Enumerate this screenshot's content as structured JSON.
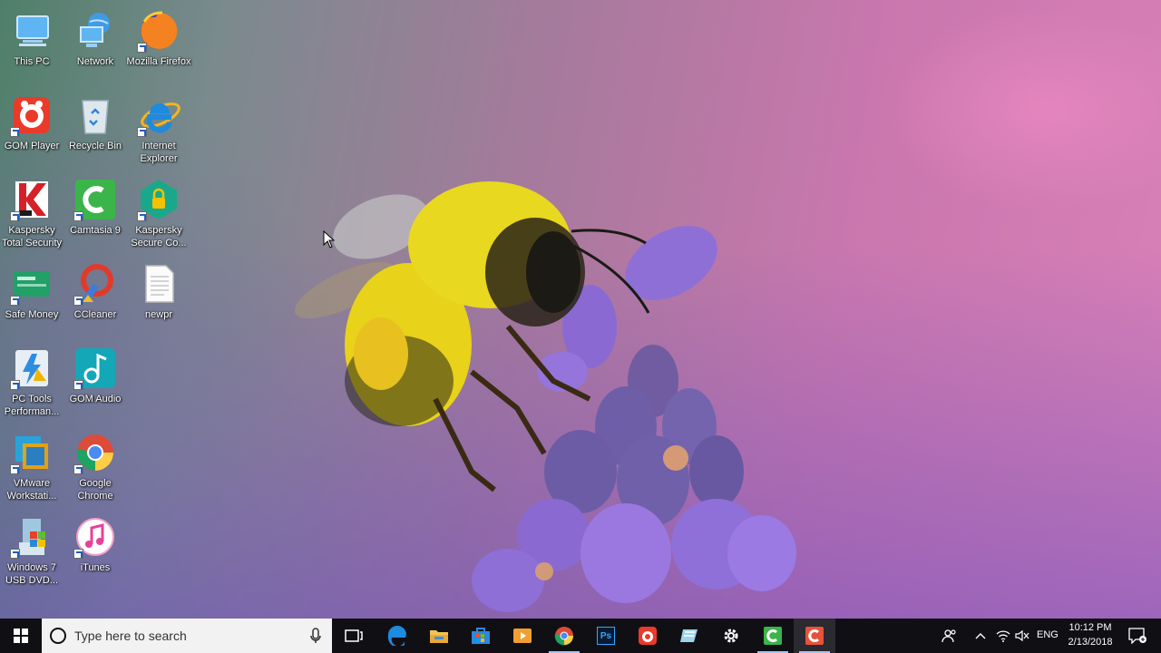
{
  "desktop": {
    "icons": [
      {
        "label": "This PC",
        "icon": "this-pc-icon"
      },
      {
        "label": "Network",
        "icon": "network-icon"
      },
      {
        "label": "Mozilla Firefox",
        "icon": "firefox-icon"
      },
      {
        "label": "GOM Player",
        "icon": "gom-player-icon"
      },
      {
        "label": "Recycle Bin",
        "icon": "recycle-bin-icon"
      },
      {
        "label": "Internet Explorer",
        "icon": "internet-explorer-icon"
      },
      {
        "label": "Kaspersky Total Security",
        "icon": "kaspersky-icon"
      },
      {
        "label": "Camtasia 9",
        "icon": "camtasia-icon"
      },
      {
        "label": "Kaspersky Secure Co...",
        "icon": "kaspersky-secure-icon"
      },
      {
        "label": "Safe Money",
        "icon": "safe-money-icon"
      },
      {
        "label": "CCleaner",
        "icon": "ccleaner-icon"
      },
      {
        "label": "newpr",
        "icon": "text-file-icon"
      },
      {
        "label": "PC Tools Performan...",
        "icon": "pc-tools-icon"
      },
      {
        "label": "GOM Audio",
        "icon": "gom-audio-icon"
      },
      {
        "label": "VMware Workstati...",
        "icon": "vmware-icon"
      },
      {
        "label": "Google Chrome",
        "icon": "chrome-icon"
      },
      {
        "label": "Windows 7 USB DVD...",
        "icon": "windows7-usb-icon"
      },
      {
        "label": "iTunes",
        "icon": "itunes-icon"
      }
    ]
  },
  "taskbar": {
    "search_placeholder": "Type here to search",
    "pinned": [
      "start-icon",
      "task-view-icon",
      "edge-icon",
      "file-explorer-icon",
      "store-icon",
      "video-player-icon",
      "chrome-icon",
      "photoshop-icon",
      "gom-player-icon",
      "notepad-icon",
      "settings-icon",
      "camtasia-icon",
      "camtasia-recorder-icon"
    ],
    "photoshop_text": "Ps",
    "language": "ENG",
    "time": "10:12 PM",
    "date": "2/13/2018"
  },
  "colors": {
    "taskbar": "#101014",
    "accent": "#0078d7"
  }
}
